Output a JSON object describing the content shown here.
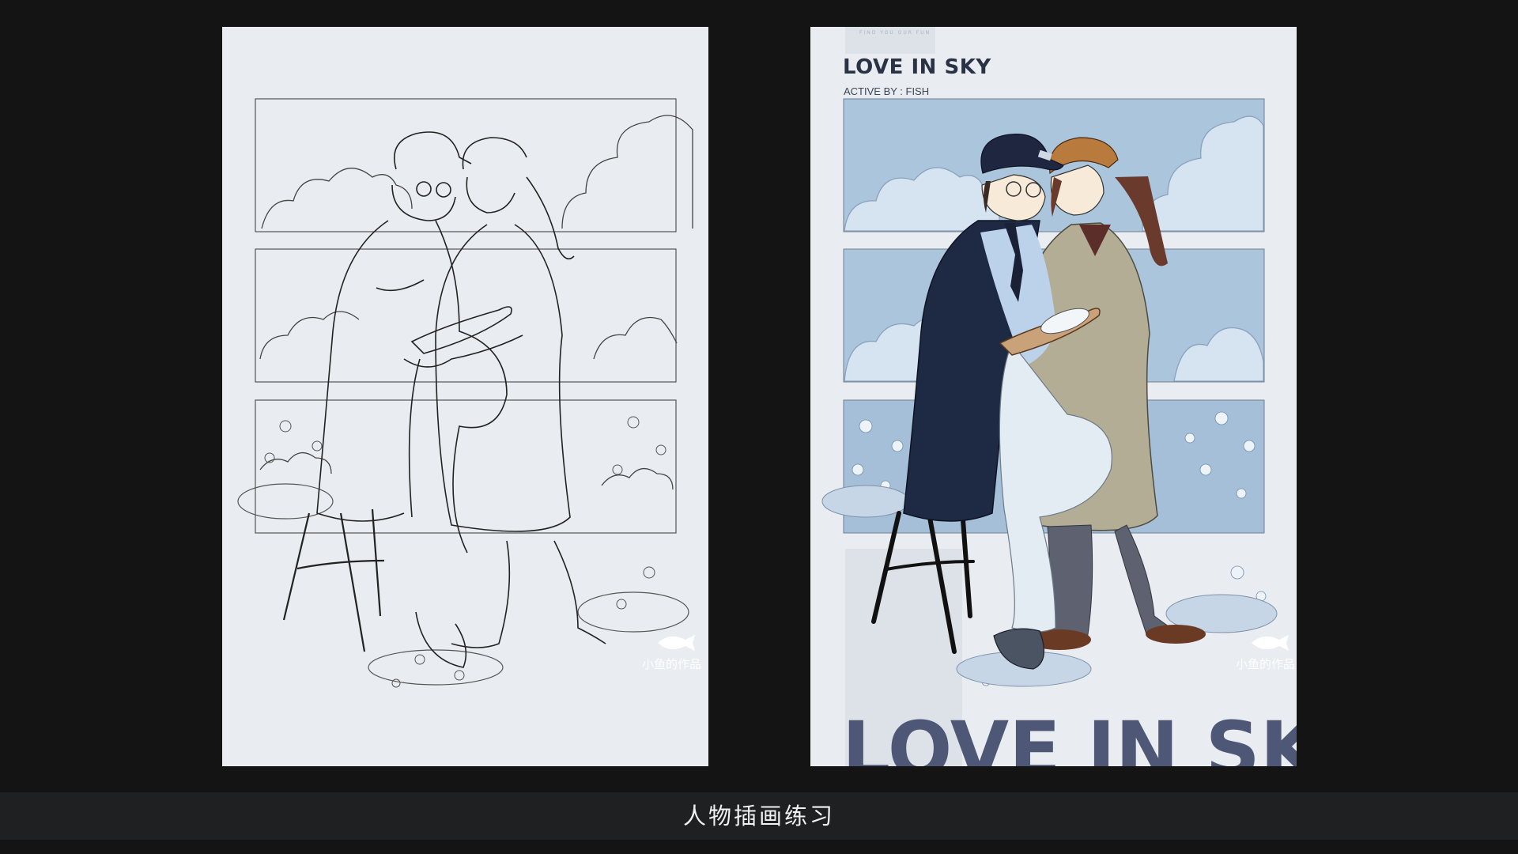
{
  "left_panel": {
    "watermark": "小鱼的作品",
    "watermark_icon": "fish-logo-icon"
  },
  "right_panel": {
    "tag_line": "FIND YOU OUR FUN",
    "title": "LOVE IN SKY",
    "credit": "ACTIVE BY : FISH",
    "big_title": "LOVE IN SKY",
    "watermark": "小鱼的作品",
    "watermark_icon": "fish-logo-icon"
  },
  "caption": "人物插画练习",
  "colors": {
    "background": "#141415",
    "panel": "#e9ecf0",
    "sky_blue": "#abc5dc",
    "navy_coat": "#1e2a44",
    "beige_coat": "#b3ad96",
    "title_text": "#2a3345",
    "caption_bar": "#1f2022"
  }
}
